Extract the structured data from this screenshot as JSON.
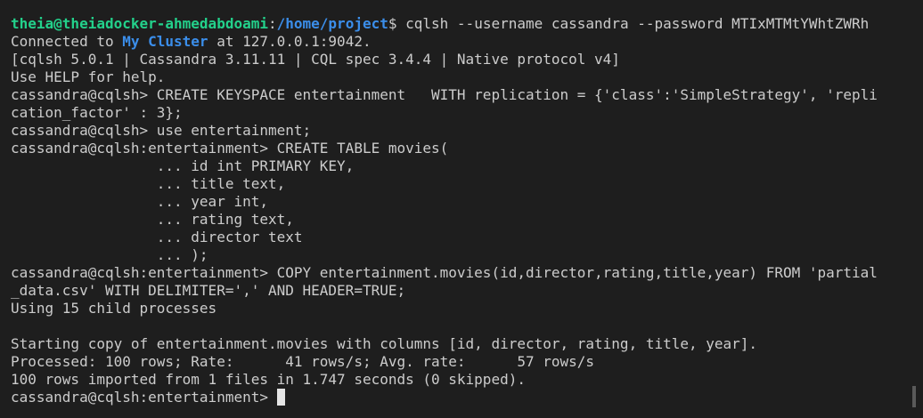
{
  "terminal": {
    "prompt_user_host": "theia@theiadocker-ahmedabdoami",
    "prompt_sep": ":",
    "prompt_path": "/home/project",
    "prompt_cmd": "$ cqlsh --username cassandra --password MTIxMTMtYWhtZWRh",
    "connected_prefix": "Connected to ",
    "cluster_name": "My Cluster",
    "connected_suffix": " at 127.0.0.1:9042.",
    "version_line": "[cqlsh 5.0.1 | Cassandra 3.11.11 | CQL spec 3.4.4 | Native protocol v4]",
    "help_line": "Use HELP for help.",
    "create_keyspace_1": "cassandra@cqlsh> CREATE KEYSPACE entertainment   WITH replication = {'class':'SimpleStrategy', 'repli",
    "create_keyspace_2": "cation_factor' : 3};",
    "use_line": "cassandra@cqlsh> use entertainment;",
    "create_table_line": "cassandra@cqlsh:entertainment> CREATE TABLE movies(",
    "col_1": "                 ... id int PRIMARY KEY,",
    "col_2": "                 ... title text,",
    "col_3": "                 ... year int,",
    "col_4": "                 ... rating text,",
    "col_5": "                 ... director text",
    "col_6": "                 ... );",
    "copy_line_1": "cassandra@cqlsh:entertainment> COPY entertainment.movies(id,director,rating,title,year) FROM 'partial",
    "copy_line_2": "_data.csv' WITH DELIMITER=',' AND HEADER=TRUE;",
    "child_processes": "Using 15 child processes",
    "blank": "",
    "starting_copy": "Starting copy of entertainment.movies with columns [id, director, rating, title, year].",
    "processed": "Processed: 100 rows; Rate:      41 rows/s; Avg. rate:      57 rows/s",
    "imported": "100 rows imported from 1 files in 1.747 seconds (0 skipped).",
    "final_prompt": "cassandra@cqlsh:entertainment> "
  },
  "colors": {
    "background": "#1e1e1e",
    "foreground": "#cccccc",
    "prompt_user": "#23d18b",
    "prompt_path": "#3b8eea"
  }
}
